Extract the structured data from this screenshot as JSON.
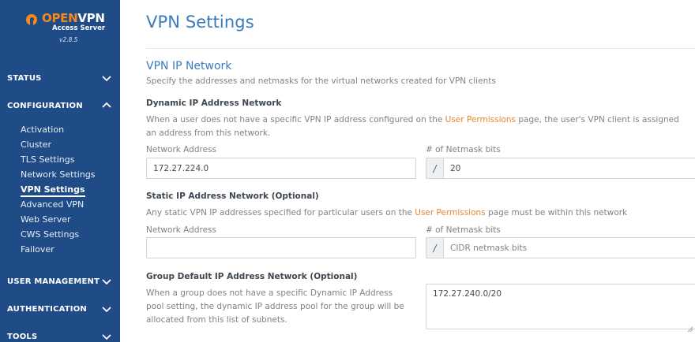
{
  "brand": {
    "name_open": "OPEN",
    "name_vpn": "VPN",
    "subtitle": "Access Server",
    "version": "v2.8.5",
    "accent_color": "#f48a1c",
    "sidebar_color": "#1f4c86"
  },
  "sidebar": {
    "sections": [
      {
        "label": "STATUS",
        "expanded": false,
        "chevron": "chevron-down-icon"
      },
      {
        "label": "CONFIGURATION",
        "expanded": true,
        "chevron": "chevron-up-icon"
      },
      {
        "label": "USER MANAGEMENT",
        "expanded": false,
        "chevron": "chevron-down-icon"
      },
      {
        "label": "AUTHENTICATION",
        "expanded": false,
        "chevron": "chevron-down-icon"
      },
      {
        "label": "TOOLS",
        "expanded": false,
        "chevron": "chevron-down-icon"
      }
    ],
    "config_items": [
      {
        "label": "Activation"
      },
      {
        "label": "Cluster"
      },
      {
        "label": "TLS Settings"
      },
      {
        "label": "Network Settings"
      },
      {
        "label": "VPN Settings",
        "active": true
      },
      {
        "label": "Advanced VPN"
      },
      {
        "label": "Web Server"
      },
      {
        "label": "CWS Settings"
      },
      {
        "label": "Failover"
      }
    ]
  },
  "page": {
    "title": "VPN Settings",
    "section_title": "VPN IP Network",
    "section_desc": "Specify the addresses and netmasks for the virtual networks created for VPN clients",
    "dynamic": {
      "heading": "Dynamic IP Address Network",
      "text_before": "When a user does not have a specific VPN IP address configured on the ",
      "link": "User Permissions",
      "text_after": " page, the user's VPN client is assigned",
      "text_line2": "an address from this network.",
      "network_label": "Network Address",
      "network_value": "172.27.224.0",
      "netmask_label": "# of Netmask bits",
      "slash": "/",
      "netmask_value": "20"
    },
    "static": {
      "heading": "Static IP Address Network (Optional)",
      "text_before": "Any static VPN IP addresses specified for particular users on the ",
      "link": "User Permissions",
      "text_after": " page must be within this network",
      "network_label": "Network Address",
      "network_value": "",
      "netmask_label": "# of Netmask bits",
      "slash": "/",
      "netmask_placeholder": "CIDR netmask bits"
    },
    "group": {
      "heading": "Group Default IP Address Network (Optional)",
      "line1": "When a group does not have a specific Dynamic IP Address",
      "line2": "pool setting, the dynamic IP address pool for the group will be",
      "line3": "allocated from this list of subnets.",
      "subnets_value": "172.27.240.0/20"
    },
    "link_color": "#e8872b",
    "title_color": "#3a7bbd"
  }
}
